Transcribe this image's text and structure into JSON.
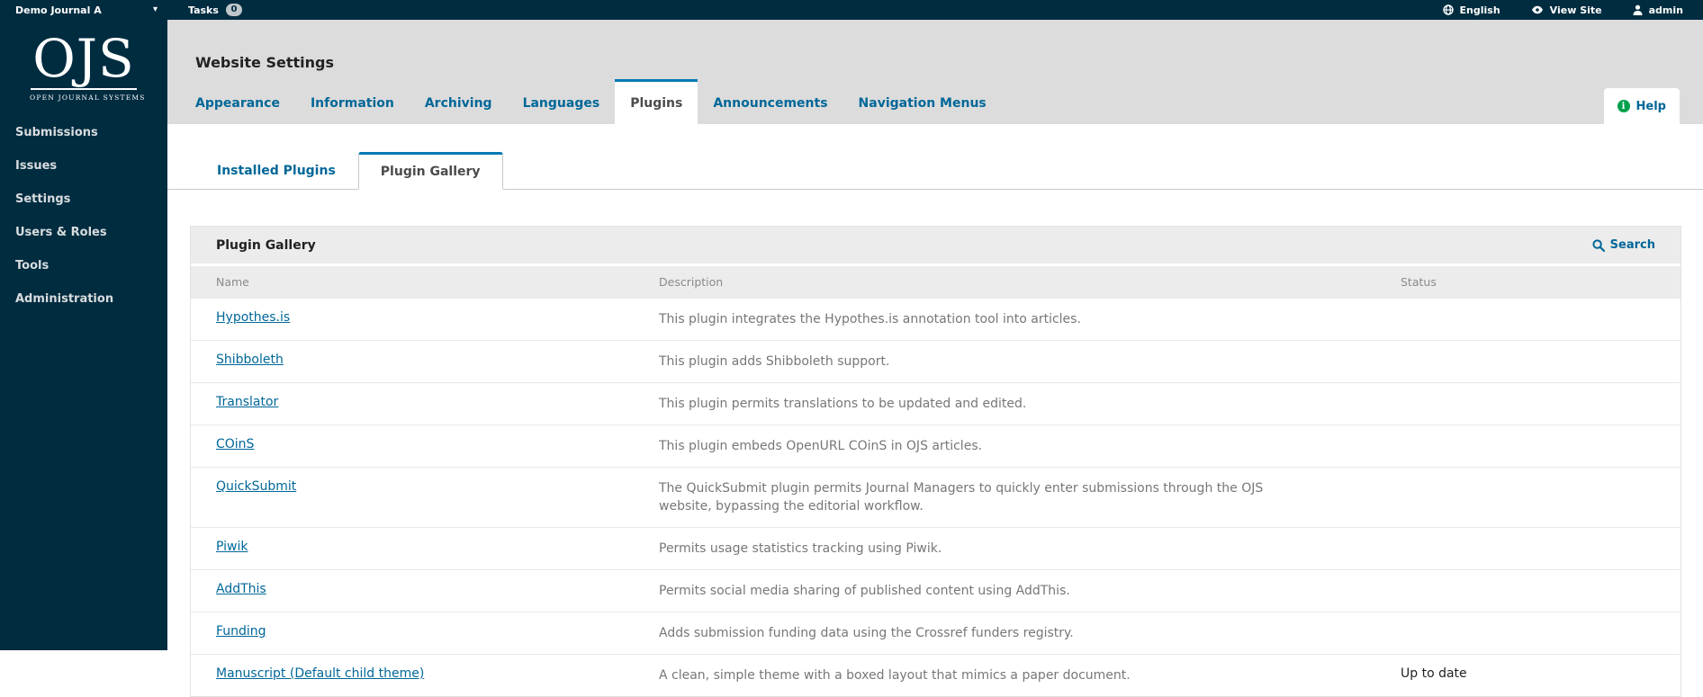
{
  "topbar": {
    "journal": "Demo Journal A",
    "tasks_label": "Tasks",
    "tasks_count": "0",
    "language_label": "English",
    "view_site_label": "View Site",
    "user_label": "admin"
  },
  "sidebar": {
    "logo": {
      "acronym": "OJS",
      "subtitle": "OPEN JOURNAL SYSTEMS"
    },
    "items": [
      {
        "label": "Submissions"
      },
      {
        "label": "Issues"
      },
      {
        "label": "Settings"
      },
      {
        "label": "Users & Roles"
      },
      {
        "label": "Tools"
      },
      {
        "label": "Administration"
      }
    ]
  },
  "page": {
    "title": "Website Settings",
    "help_label": "Help",
    "tabs": [
      {
        "label": "Appearance",
        "active": false
      },
      {
        "label": "Information",
        "active": false
      },
      {
        "label": "Archiving",
        "active": false
      },
      {
        "label": "Languages",
        "active": false
      },
      {
        "label": "Plugins",
        "active": true
      },
      {
        "label": "Announcements",
        "active": false
      },
      {
        "label": "Navigation Menus",
        "active": false
      }
    ],
    "subtabs": [
      {
        "label": "Installed Plugins",
        "active": false
      },
      {
        "label": "Plugin Gallery",
        "active": true
      }
    ]
  },
  "panel": {
    "title": "Plugin Gallery",
    "search_label": "Search",
    "columns": {
      "name": "Name",
      "description": "Description",
      "status": "Status"
    },
    "rows": [
      {
        "name": "Hypothes.is",
        "description": "This plugin integrates the Hypothes.is annotation tool into articles.",
        "status": ""
      },
      {
        "name": "Shibboleth",
        "description": "This plugin adds Shibboleth support.",
        "status": ""
      },
      {
        "name": "Translator",
        "description": "This plugin permits translations to be updated and edited.",
        "status": ""
      },
      {
        "name": "COinS",
        "description": "This plugin embeds OpenURL COinS in OJS articles.",
        "status": ""
      },
      {
        "name": "QuickSubmit",
        "description": "The QuickSubmit plugin permits Journal Managers to quickly enter submissions through the OJS website, bypassing the editorial workflow.",
        "status": ""
      },
      {
        "name": "Piwik",
        "description": "Permits usage statistics tracking using Piwik.",
        "status": ""
      },
      {
        "name": "AddThis",
        "description": "Permits social media sharing of published content using AddThis.",
        "status": ""
      },
      {
        "name": "Funding",
        "description": "Adds submission funding data using the Crossref funders registry.",
        "status": ""
      },
      {
        "name": "Manuscript (Default child theme)",
        "description": "A clean, simple theme with a boxed layout that mimics a paper document.",
        "status": "Up to date"
      }
    ],
    "colors": {
      "accent_blue": "#006798",
      "active_border_blue": "#007AB2",
      "dark_navy": "#002C40",
      "help_green": "#00A14B"
    }
  }
}
